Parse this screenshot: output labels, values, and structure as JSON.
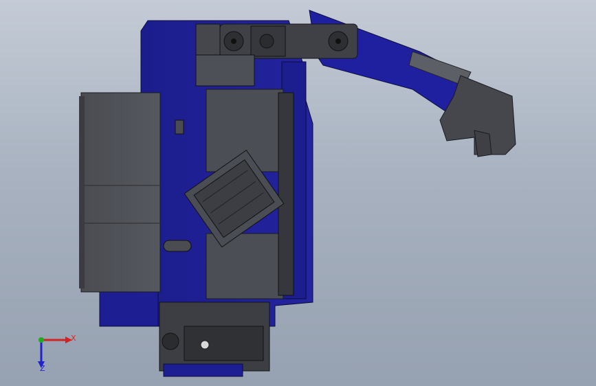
{
  "viewport": {
    "background_top": "#c4cbd6",
    "background_bottom": "#96a1b1"
  },
  "colors": {
    "blue_dark": "#17177a",
    "blue_mid": "#1e1f9a",
    "blue_light": "#2a2cb4",
    "grey_dark": "#3b3d42",
    "grey_mid": "#4a4c52",
    "grey_light": "#5a5d63",
    "edge": "#1a1a1e"
  },
  "triad": {
    "x_label": "X",
    "z_label": "Z",
    "x_color": "#d22222",
    "y_color": "#22aa22",
    "z_color": "#2222cc"
  }
}
